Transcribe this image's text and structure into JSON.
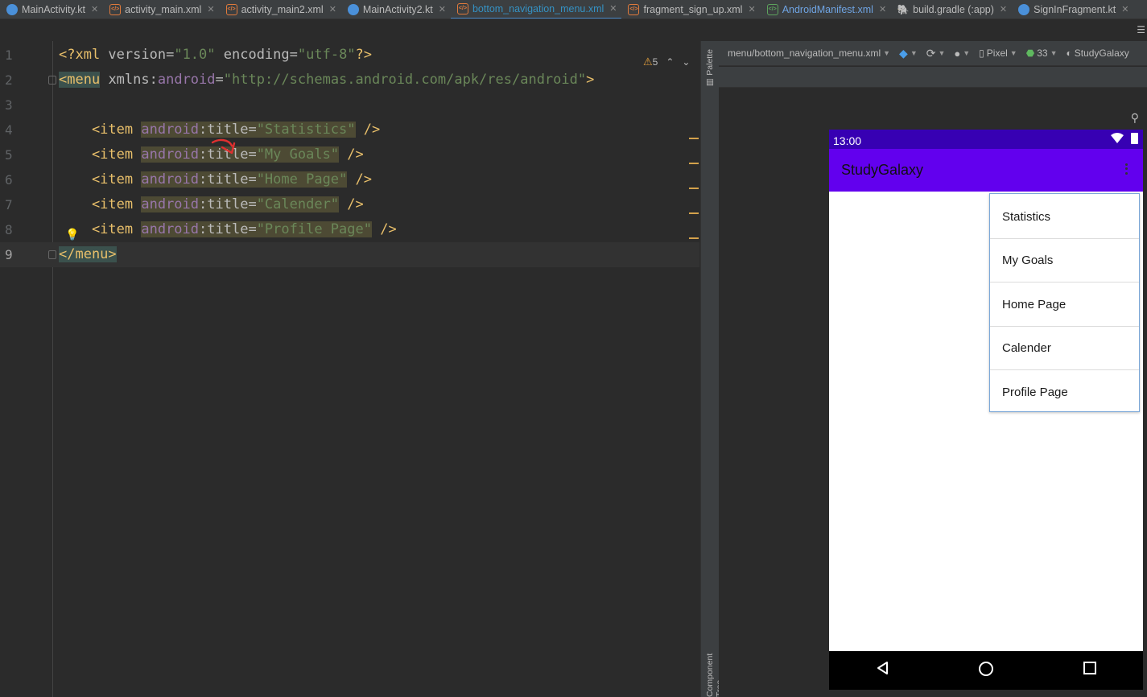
{
  "tabs": [
    {
      "label": "MainActivity.kt",
      "kind": "kt"
    },
    {
      "label": "activity_main.xml",
      "kind": "xml"
    },
    {
      "label": "activity_main2.xml",
      "kind": "xml"
    },
    {
      "label": "MainActivity2.kt",
      "kind": "kt"
    },
    {
      "label": "bottom_navigation_menu.xml",
      "kind": "xml",
      "active": true
    },
    {
      "label": "fragment_sign_up.xml",
      "kind": "xml"
    },
    {
      "label": "AndroidManifest.xml",
      "kind": "manifest"
    },
    {
      "label": "build.gradle (:app)",
      "kind": "gradle"
    },
    {
      "label": "SignInFragment.kt",
      "kind": "kt"
    }
  ],
  "editor": {
    "line_numbers": [
      "1",
      "2",
      "3",
      "4",
      "5",
      "6",
      "7",
      "8",
      "9"
    ],
    "xml_decl": {
      "open": "<?xml ",
      "version_attr": "version",
      "eq": "=",
      "version_val": "\"1.0\"",
      "encoding_attr": " encoding",
      "encoding_val": "\"utf-8\"",
      "close": "?>"
    },
    "menu_open": {
      "tag": "<menu",
      "attr_ns": "xmlns:",
      "attr_name": "android",
      "eq": "=",
      "value": "\"http://schemas.android.com/apk/res/android\"",
      "close": ">"
    },
    "item_prefix": "    <item ",
    "attr_ns": "android",
    "attr_name": ":title",
    "eq": "=",
    "item_close": " />",
    "items": [
      "\"Statistics\"",
      "\"My Goals\"",
      "\"Home Page\"",
      "\"Calender\"",
      "\"Profile Page\""
    ],
    "menu_close": "</menu>",
    "warning_count": "5",
    "colors": {
      "tag": "#e8bf6a",
      "namespace": "#9876aa",
      "value": "#6a8759",
      "arrow": "#e03030"
    }
  },
  "side_strip": {
    "palette": "Palette",
    "component_tree": "Component Tree"
  },
  "design_toolbar": {
    "file": "menu/bottom_navigation_menu.xml",
    "device": "Pixel",
    "api": "33",
    "theme": "StudyGalaxy"
  },
  "phone": {
    "time": "13:00",
    "app_title": "StudyGalaxy",
    "menu_items": [
      "Statistics",
      "My Goals",
      "Home Page",
      "Calender",
      "Profile Page"
    ],
    "colors": {
      "status_bar": "#3700b3",
      "app_bar": "#6200ee"
    }
  }
}
